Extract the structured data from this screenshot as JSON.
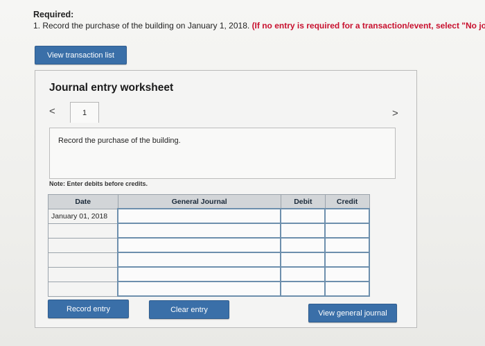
{
  "required": {
    "title": "Required:",
    "instruction_prefix": "1. Record the purchase of the building on January 1, 2018.",
    "instruction_hint": "(If no entry is required for a transaction/event, select \"No jo"
  },
  "toolbar": {
    "view_transaction_list": "View transaction list"
  },
  "worksheet": {
    "title": "Journal entry worksheet",
    "prev_icon": "<",
    "next_icon": ">",
    "tab_label": "1",
    "description": "Record the purchase of the building.",
    "note": "Note: Enter debits before credits.",
    "table": {
      "headers": [
        "Date",
        "General Journal",
        "Debit",
        "Credit"
      ],
      "rows": [
        [
          "January 01, 2018",
          "",
          "",
          ""
        ],
        [
          "",
          "",
          "",
          ""
        ],
        [
          "",
          "",
          "",
          ""
        ],
        [
          "",
          "",
          "",
          ""
        ],
        [
          "",
          "",
          "",
          ""
        ],
        [
          "",
          "",
          "",
          ""
        ]
      ]
    },
    "buttons": {
      "record": "Record entry",
      "clear": "Clear entry",
      "view_general_journal": "View general journal"
    }
  }
}
